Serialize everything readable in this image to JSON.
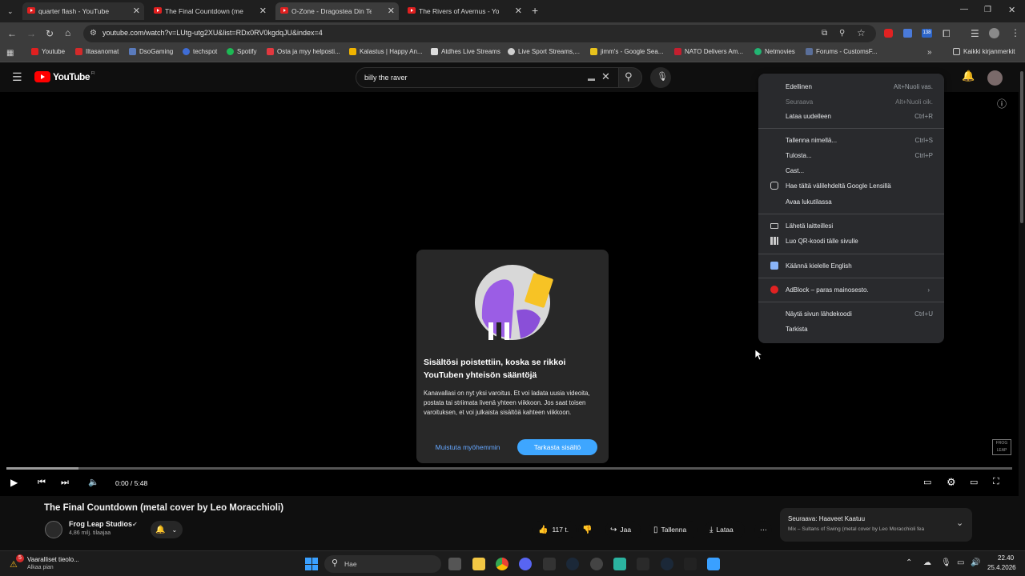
{
  "browser": {
    "tabs": [
      {
        "title": "quarter flash - YouTube",
        "state": "hover"
      },
      {
        "title": "The Final Countdown (metal co",
        "state": "normal"
      },
      {
        "title": "O-Zone - Dragostea Din Tei [Of",
        "state": "active"
      },
      {
        "title": "The Rivers of Avernus - YouTub",
        "state": "normal"
      }
    ],
    "url": "youtube.com/watch?v=LUtg-utg2XU&list=RDx0RV0kgdqJU&index=4",
    "bookmarks": [
      "Youtube",
      "Iltasanomat",
      "DsoGaming",
      "techspot",
      "Spotify",
      "Osta ja myy helposti...",
      "Kalastus | Happy An...",
      "Atdhes Live Streams",
      "Live Sport Streams,...",
      "jimm's - Google Sea...",
      "NATO Delivers Am...",
      "Netmovies",
      "Forums - CustomsF..."
    ],
    "all_bookmarks": "Kaikki kirjanmerkit",
    "profile_badge": "138"
  },
  "youtube": {
    "logo": "YouTube",
    "region": "FI",
    "search_value": "billy the raver",
    "video_title": "The Final Countdown (metal cover by Leo Moracchioli)",
    "channel_name": "Frog Leap Studios",
    "subscribers": "4,86 milj. tilaajaa",
    "time": "0:00 / 5:48",
    "likes": "117 t.",
    "share": "Jaa",
    "save": "Tallenna",
    "download": "Lataa",
    "next_label": "Seuraava: Haaveet Kaatuu",
    "next_sub": "Mix – Sultans of Swing (metal cover by Leo Moracchioli fea"
  },
  "dialog": {
    "title": "Sisältösi poistettiin, koska se rikkoi YouTuben yhteisön sääntöjä",
    "body": "Kanavallasi on nyt yksi varoitus. Et voi ladata uusia videoita, postata tai striimata livenä yhteen viikkoon. Jos saat toisen varoituksen, et voi julkaista sisältöä kahteen viikkoon.",
    "later": "Muistuta myöhemmin",
    "check": "Tarkasta sisältö"
  },
  "context_menu": {
    "items": [
      {
        "label": "Edellinen",
        "shortcut": "Alt+Nuoli vas.",
        "disabled": false
      },
      {
        "label": "Seuraava",
        "shortcut": "Alt+Nuoli oik.",
        "disabled": true
      },
      {
        "label": "Lataa uudelleen",
        "shortcut": "Ctrl+R",
        "disabled": false
      },
      {
        "label": "Tallenna nimellä...",
        "shortcut": "Ctrl+S",
        "disabled": false
      },
      {
        "label": "Tulosta...",
        "shortcut": "Ctrl+P",
        "disabled": false
      },
      {
        "label": "Cast...",
        "shortcut": "",
        "disabled": false
      },
      {
        "label": "Hae tältä välilehdeltä Google Lensillä",
        "shortcut": "",
        "disabled": false
      },
      {
        "label": "Avaa lukutilassa",
        "shortcut": "",
        "disabled": false
      },
      {
        "label": "Lähetä laitteillesi",
        "shortcut": "",
        "disabled": false
      },
      {
        "label": "Luo QR-koodi tälle sivulle",
        "shortcut": "",
        "disabled": false
      },
      {
        "label": "Käännä kielelle English",
        "shortcut": "",
        "disabled": false
      },
      {
        "label": "AdBlock – paras mainosesto.",
        "shortcut": "",
        "disabled": false
      },
      {
        "label": "Näytä sivun lähdekoodi",
        "shortcut": "Ctrl+U",
        "disabled": false
      },
      {
        "label": "Tarkista",
        "shortcut": "",
        "disabled": false
      }
    ]
  },
  "taskbar": {
    "notification_title": "Vaaralliset tieolo...",
    "notification_sub": "Alkaa pian",
    "notification_count": "5",
    "search_placeholder": "Hae",
    "clock_time": "22.40",
    "clock_date": "25.4.2026"
  },
  "colors": {
    "accent_blue": "#3ea6ff",
    "youtube_red": "#ff0000",
    "menu_bg": "#292a2d"
  }
}
